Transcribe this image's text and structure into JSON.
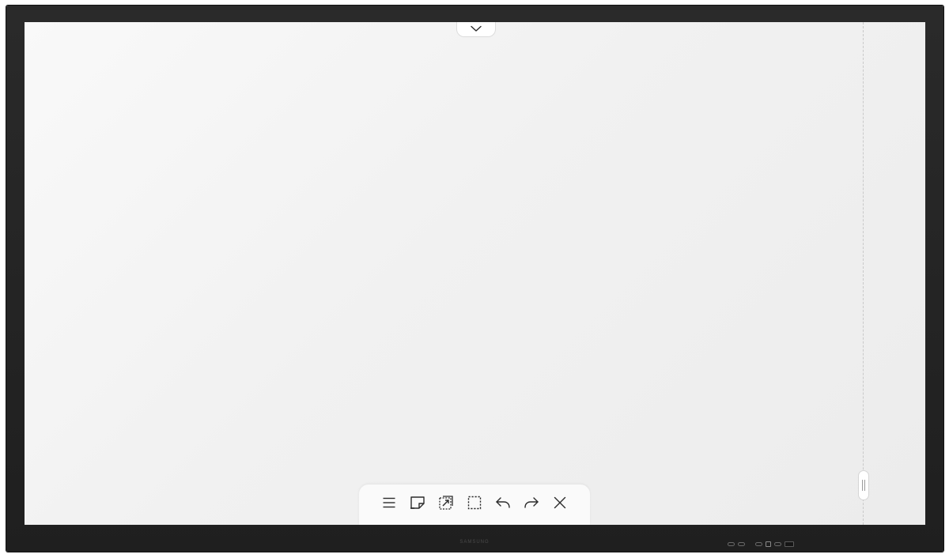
{
  "device": {
    "brand": "SAMSUNG"
  },
  "screen": {
    "top_handle_icon": "chevron-down-icon",
    "side_handle_icon": "grip-icon"
  },
  "toolbar": {
    "items": [
      {
        "name": "menu",
        "icon": "menu-icon"
      },
      {
        "name": "sticky-note",
        "icon": "sticky-note-icon"
      },
      {
        "name": "import-note",
        "icon": "import-note-icon"
      },
      {
        "name": "select",
        "icon": "select-area-icon"
      },
      {
        "name": "undo",
        "icon": "undo-icon"
      },
      {
        "name": "redo",
        "icon": "redo-icon"
      },
      {
        "name": "close",
        "icon": "close-icon"
      }
    ]
  },
  "colors": {
    "bezel": "#222222",
    "canvas": "#f3f3f3",
    "icon": "#2b2b2b"
  }
}
